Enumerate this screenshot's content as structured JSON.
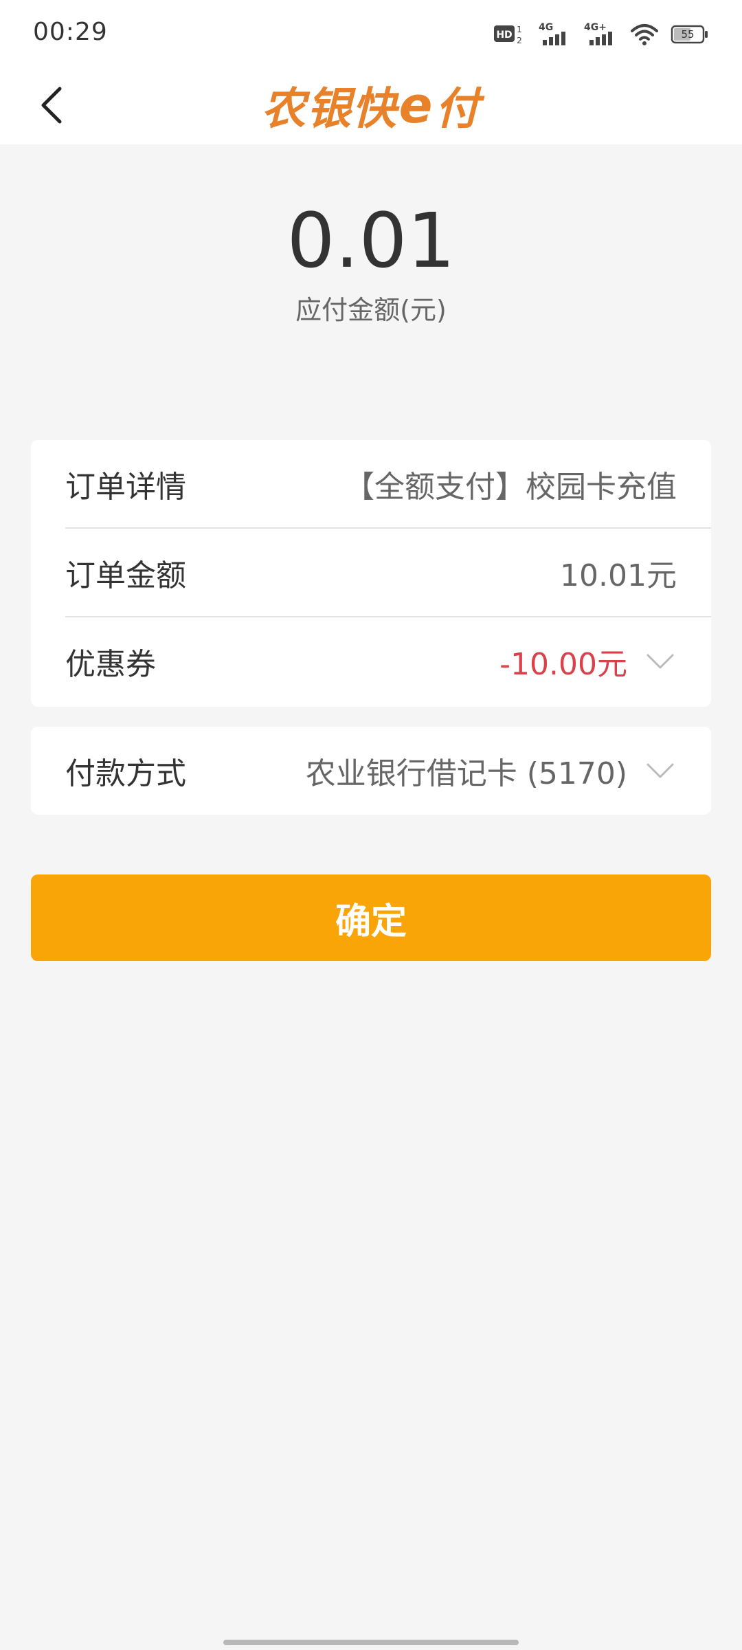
{
  "status_bar": {
    "time": "00:29",
    "hd_label": "HD",
    "network_1": "4G",
    "network_2": "4G+",
    "battery": "55",
    "icons": [
      "hd-icon",
      "signal-4g-icon",
      "signal-4g-plus-icon",
      "wifi-icon",
      "battery-icon"
    ]
  },
  "header": {
    "back_icon": "chevron-left-icon",
    "brand_part1": "农银快",
    "brand_e": "e",
    "brand_part2": "付",
    "brand_color": "#e8822a"
  },
  "amount": {
    "value": "0.01",
    "label": "应付金额(元)"
  },
  "order_card": {
    "rows": [
      {
        "label": "订单详情",
        "value": "【全额支付】校园卡充值"
      },
      {
        "label": "订单金额",
        "value": "10.01元"
      },
      {
        "label": "优惠券",
        "value": "-10.00元",
        "value_color": "#d9424a",
        "icon": "chevron-down-icon"
      }
    ]
  },
  "payment_card": {
    "label": "付款方式",
    "value": "农业银行借记卡 (5170)",
    "icon": "chevron-down-icon"
  },
  "confirm_button": {
    "label": "确定",
    "color": "#faa507"
  }
}
